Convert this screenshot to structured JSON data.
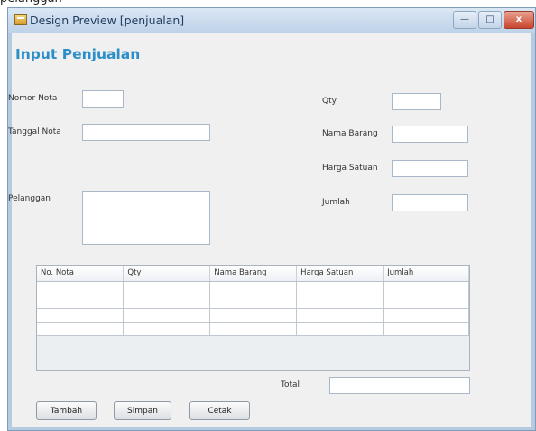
{
  "above_window_text": "pelanggan",
  "window": {
    "title": "Design Preview [penjualan]",
    "controls": {
      "minimize": "—",
      "maximize": "□",
      "close": "x"
    }
  },
  "form": {
    "heading": "Input Penjualan",
    "labels": {
      "nomor_nota": "Nomor Nota",
      "tanggal_nota": "Tanggal Nota",
      "pelanggan": "Pelanggan",
      "qty": "Qty",
      "nama_barang": "Nama Barang",
      "harga_satuan": "Harga Satuan",
      "jumlah": "Jumlah",
      "total": "Total"
    },
    "values": {
      "nomor_nota": "",
      "tanggal_nota": "",
      "pelanggan": "",
      "qty": "",
      "nama_barang": "",
      "harga_satuan": "",
      "jumlah": "",
      "total": ""
    }
  },
  "table": {
    "columns": [
      "No. Nota",
      "Qty",
      "Nama Barang",
      "Harga Satuan",
      "Jumlah"
    ],
    "rows": [
      [
        "",
        "",
        "",
        "",
        ""
      ],
      [
        "",
        "",
        "",
        "",
        ""
      ],
      [
        "",
        "",
        "",
        "",
        ""
      ],
      [
        "",
        "",
        "",
        "",
        ""
      ]
    ]
  },
  "buttons": {
    "tambah": "Tambah",
    "simpan": "Simpan",
    "cetak": "Cetak"
  }
}
